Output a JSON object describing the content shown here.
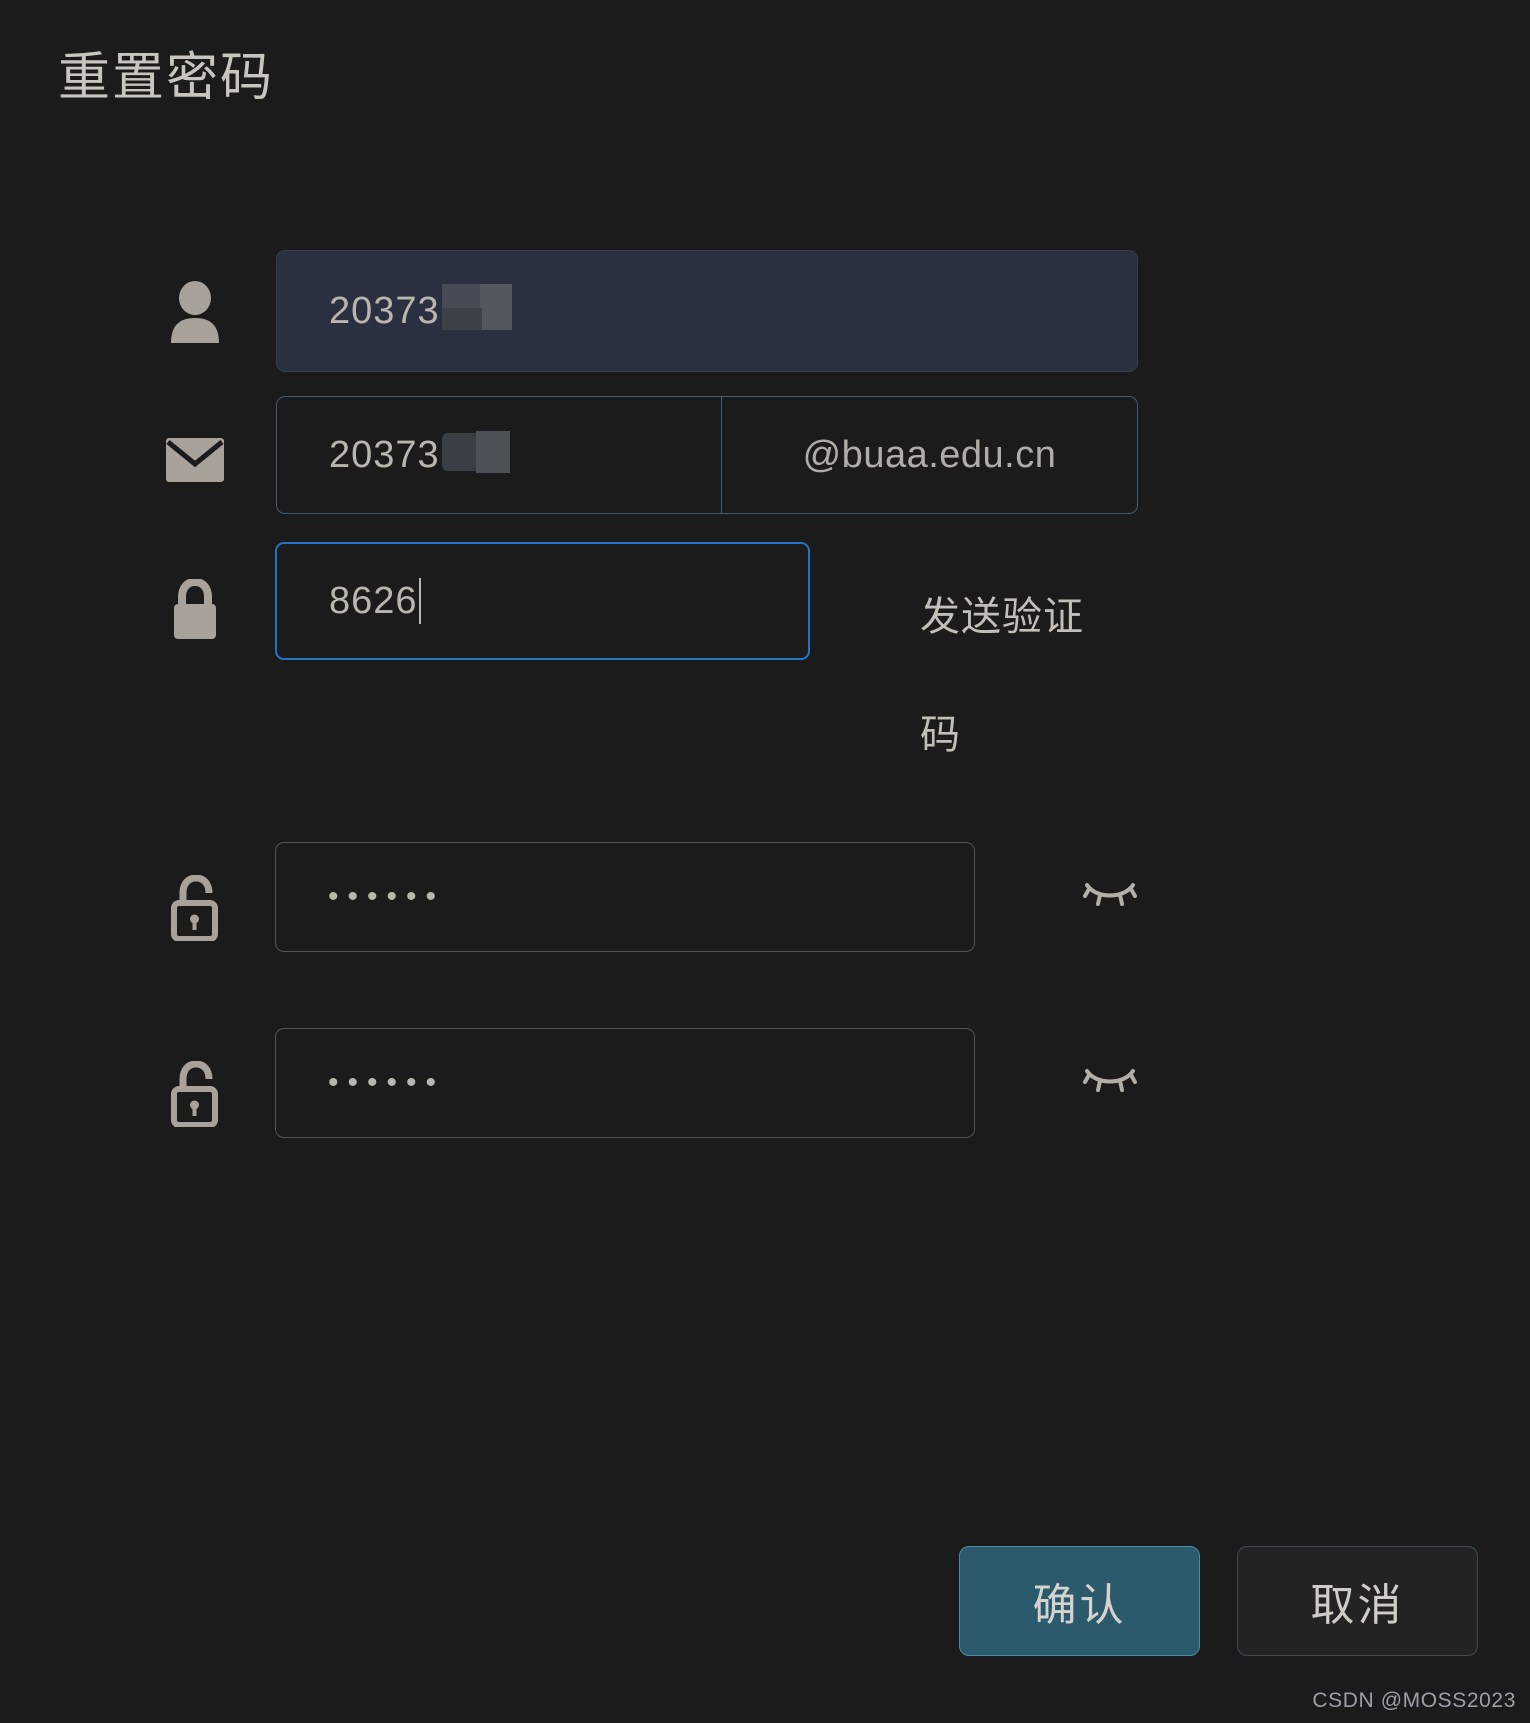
{
  "dialog": {
    "title": "重置密码",
    "background_color": "#1b1b1b"
  },
  "fields": {
    "username": {
      "icon": "person-icon",
      "value": "20373",
      "redacted": true,
      "background_color": "#2a3040",
      "border_color": "#353c4d"
    },
    "email": {
      "icon": "mail-icon",
      "value": "20373",
      "redacted": true,
      "suffix": "@buaa.edu.cn",
      "border_color": "#47596d"
    },
    "verification_code": {
      "icon": "lock-icon",
      "value": "8626",
      "focused": true,
      "border_color": "#2473c4",
      "send_button_label": "发送验证码"
    },
    "password": {
      "icon": "lock-open-icon",
      "value": "••••••",
      "masked": true,
      "toggle_icon": "eye-off-icon",
      "border_color": "#4c5652"
    },
    "password_confirm": {
      "icon": "lock-open-icon",
      "value": "••••••",
      "masked": true,
      "toggle_icon": "eye-off-icon",
      "border_color": "#4c5652"
    }
  },
  "footer": {
    "confirm_label": "确认",
    "cancel_label": "取消",
    "confirm_color": "#2b5a6d",
    "cancel_color": "#232323"
  },
  "watermark": {
    "text": "CSDN @MOSS2023"
  }
}
